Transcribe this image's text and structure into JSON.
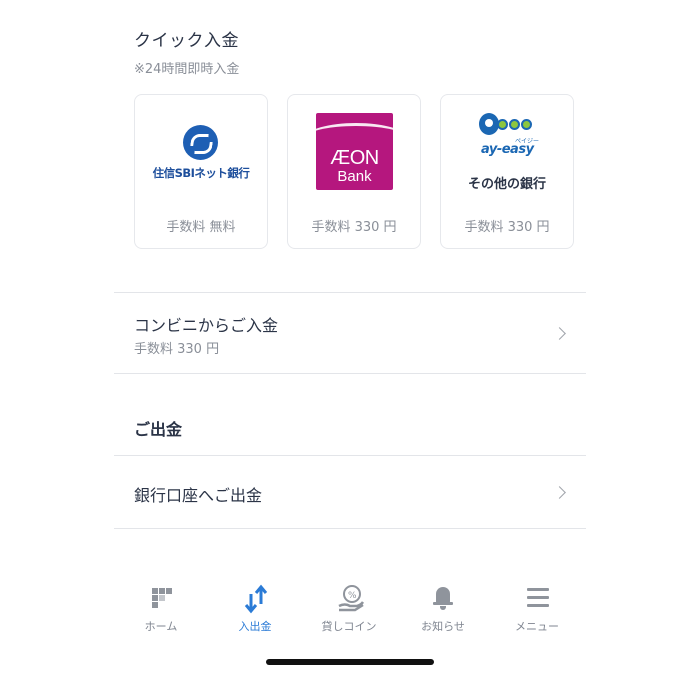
{
  "quick_deposit": {
    "title": "クイック入金",
    "subtitle": "※24時間即時入金",
    "cards": [
      {
        "logo_text": "住信SBIネット銀行",
        "fee": "手数料 無料",
        "logo_icon": "sbi-bank-logo"
      },
      {
        "logo_text_top": "ÆON",
        "logo_text_bottom": "Bank",
        "fee": "手数料 330 円",
        "logo_icon": "aeon-bank-logo",
        "brand_color": "#b5177e"
      },
      {
        "logo_kana": "ペイジー",
        "logo_word": "ay-easy",
        "label": "その他の銀行",
        "fee": "手数料 330 円",
        "logo_icon": "pay-easy-logo",
        "brand_color": "#1b67b3"
      }
    ]
  },
  "convenience": {
    "label": "コンビニからご入金",
    "fee": "手数料 330 円"
  },
  "withdraw": {
    "heading": "ご出金",
    "bank_row_label": "銀行口座へご出金"
  },
  "nav": {
    "items": [
      {
        "label": "ホーム",
        "icon": "home-grid-icon"
      },
      {
        "label": "入出金",
        "icon": "transfer-arrows-icon",
        "active": true
      },
      {
        "label": "貸しコイン",
        "icon": "lend-coin-icon"
      },
      {
        "label": "お知らせ",
        "icon": "bell-icon"
      },
      {
        "label": "メニュー",
        "icon": "menu-icon"
      }
    ],
    "active_color": "#2b7bd6",
    "inactive_color": "#8f949c"
  }
}
